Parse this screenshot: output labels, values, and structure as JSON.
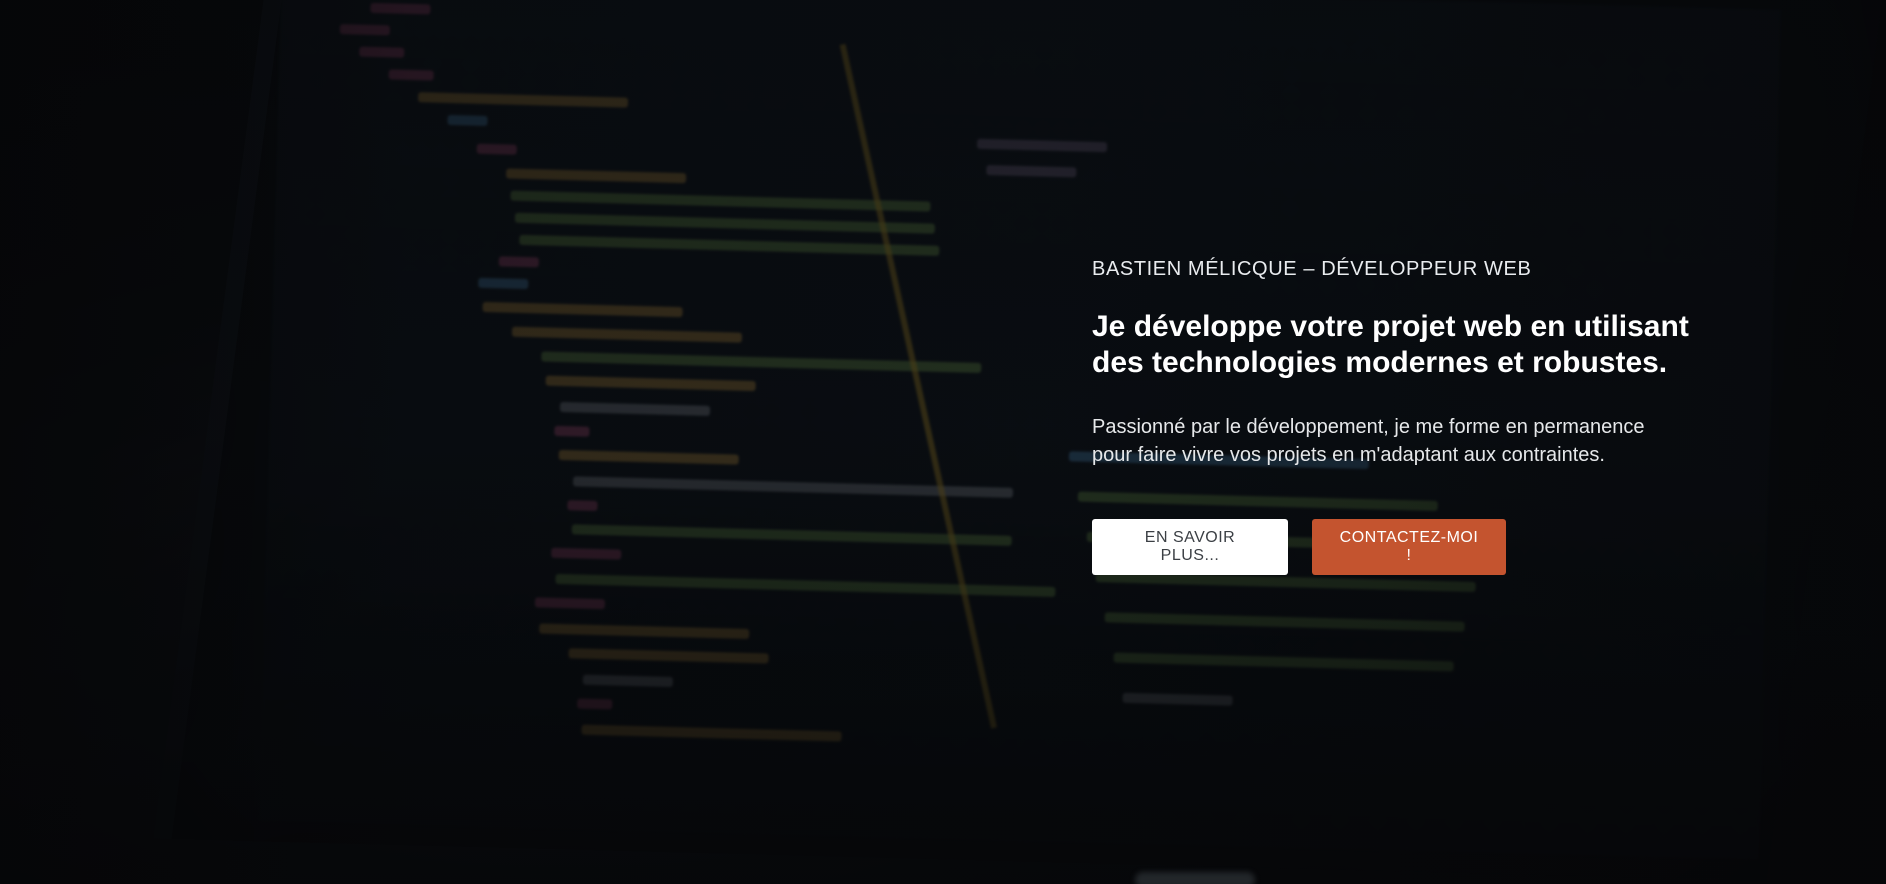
{
  "hero": {
    "eyebrow": "BASTIEN MÉLICQUE – DÉVELOPPEUR WEB",
    "headline_line1": "Je développe votre projet web en utilisant",
    "headline_line2": "des technologies modernes et robustes.",
    "lead_line1": "Passionné par le développement, je me forme en permanence",
    "lead_line2": "pour faire vivre vos projets en m'adaptant aux contraintes.",
    "primary_button": "EN SAVOIR PLUS...",
    "secondary_button": "CONTACTEZ-MOI !"
  },
  "colors": {
    "accent": "#c4542f",
    "primary_button_bg": "#ffffff",
    "background": "#07090c"
  }
}
